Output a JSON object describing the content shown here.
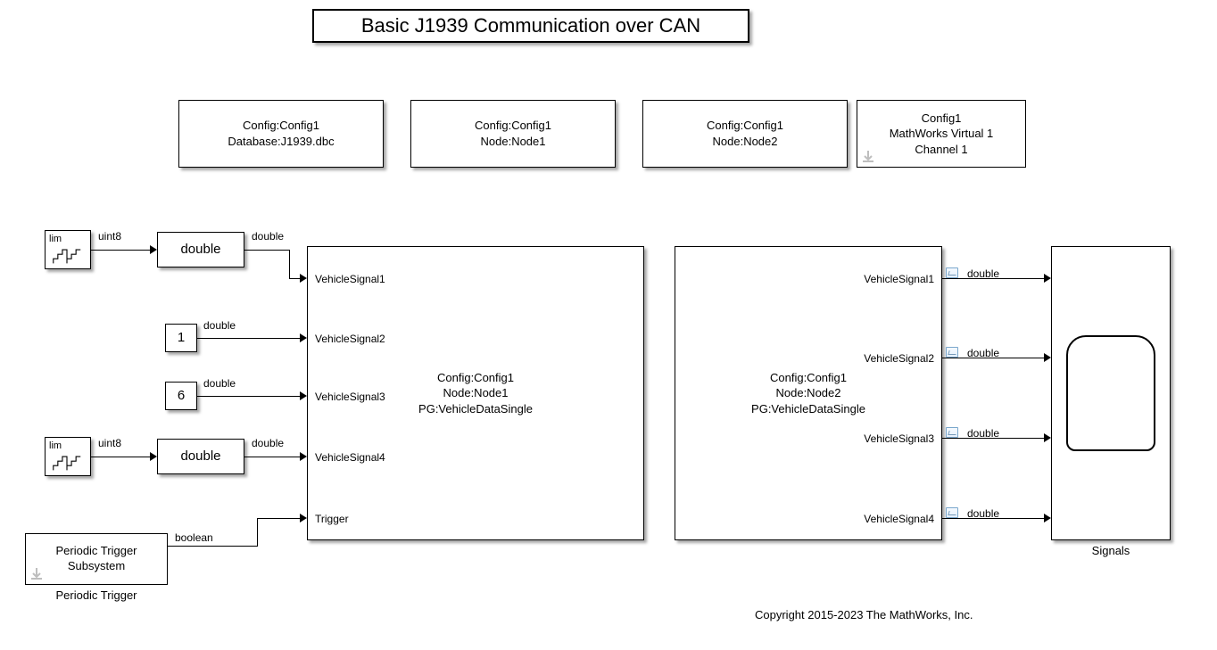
{
  "title": "Basic J1939 Communication over CAN",
  "config_blocks": [
    {
      "line1": "Config:Config1",
      "line2": "Database:J1939.dbc"
    },
    {
      "line1": "Config:Config1",
      "line2": "Node:Node1"
    },
    {
      "line1": "Config:Config1",
      "line2": "Node:Node2"
    },
    {
      "line1": "Config1",
      "line2": "MathWorks Virtual 1",
      "line3": "Channel 1"
    }
  ],
  "sources": {
    "counter1_badge": "lim",
    "counter1_type": "uint8",
    "conv1_label": "double",
    "conv1_type": "double",
    "const1_value": "1",
    "const1_type": "double",
    "const2_value": "6",
    "const2_type": "double",
    "counter2_badge": "lim",
    "counter2_type": "uint8",
    "conv2_label": "double",
    "conv2_type": "double",
    "trigger_block_line1": "Periodic Trigger",
    "trigger_block_line2": "Subsystem",
    "trigger_type": "boolean",
    "trigger_caption": "Periodic Trigger"
  },
  "tx_block": {
    "line1": "Config:Config1",
    "line2": "Node:Node1",
    "line3": "PG:VehicleDataSingle",
    "ports": [
      "VehicleSignal1",
      "VehicleSignal2",
      "VehicleSignal3",
      "VehicleSignal4",
      "Trigger"
    ]
  },
  "rx_block": {
    "line1": "Config:Config1",
    "line2": "Node:Node2",
    "line3": "PG:VehicleDataSingle",
    "ports": [
      "VehicleSignal1",
      "VehicleSignal2",
      "VehicleSignal3",
      "VehicleSignal4"
    ],
    "out_type": "double"
  },
  "scope": {
    "caption": "Signals"
  },
  "copyright": "Copyright 2015-2023 The MathWorks, Inc."
}
